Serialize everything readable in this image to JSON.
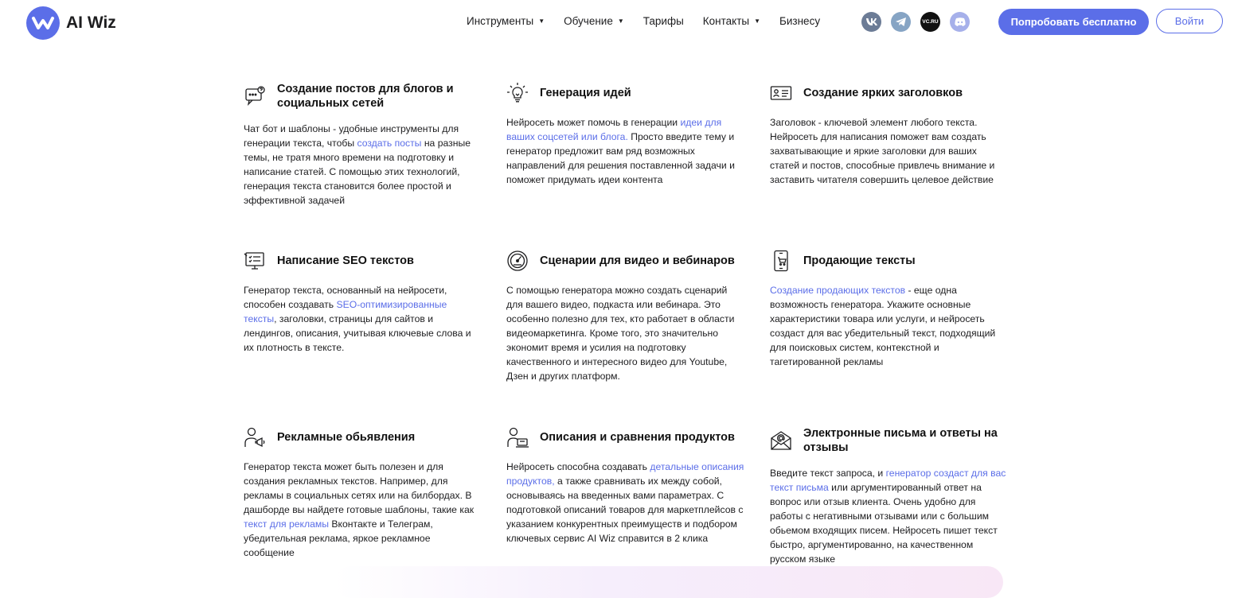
{
  "header": {
    "logo_text": "AI Wiz",
    "nav": [
      {
        "label": "Инструменты",
        "dropdown": true
      },
      {
        "label": "Обучение",
        "dropdown": true
      },
      {
        "label": "Тарифы",
        "dropdown": false
      },
      {
        "label": "Контакты",
        "dropdown": true
      },
      {
        "label": "Бизнесу",
        "dropdown": false
      }
    ],
    "socials": [
      "vk",
      "telegram",
      "vc.ru",
      "discord"
    ],
    "vc_label": "VC.RU",
    "try_free": "Попробовать бесплатно",
    "login": "Войти"
  },
  "colors": {
    "accent": "#5b6ee8",
    "text": "#1d1d1f",
    "link": "#5b6ee8"
  },
  "cards": [
    {
      "icon": "chat-bubble-icon",
      "title": "Создание постов для блогов и социальных сетей",
      "parts": [
        {
          "t": "Чат бот и шаблоны - удобные инструменты для генерации текста, чтобы "
        },
        {
          "t": "создать посты",
          "link": true
        },
        {
          "t": " на разные темы, не тратя много времени на подготовку и написание статей. С помощью этих технологий, генерация текста становится более простой и эффективной задачей"
        }
      ]
    },
    {
      "icon": "lightbulb-icon",
      "title": "Генерация идей",
      "parts": [
        {
          "t": "Нейросеть может помочь в генерации "
        },
        {
          "t": "идеи для ваших соцсетей или блога.",
          "link": true
        },
        {
          "t": " Просто введите тему и генератор предложит вам ряд возможных направлений для решения поставленной задачи и поможет придумать идеи контента"
        }
      ]
    },
    {
      "icon": "id-card-icon",
      "title": "Создание ярких заголовков",
      "parts": [
        {
          "t": "Заголовок - ключевой элемент любого текста. Нейросеть для написания поможет вам создать захватывающие и яркие заголовки для ваших статей и постов, способные привлечь внимание и заставить читателя совершить целевое действие"
        }
      ]
    },
    {
      "icon": "monitor-checklist-icon",
      "title": "Написание SEO текстов",
      "parts": [
        {
          "t": "Генератор текста, основанный на нейросети, способен создавать "
        },
        {
          "t": "SEO-оптимизированные тексты",
          "link": true
        },
        {
          "t": ", заголовки, страницы для сайтов и лендингов, описания, учитывая ключевые слова и их плотность в тексте."
        }
      ]
    },
    {
      "icon": "gauge-icon",
      "title": "Сценарии для видео и вебинаров",
      "parts": [
        {
          "t": "С помощью генератора можно создать сценарий для вашего видео, подкаста или вебинара. Это особенно полезно для тех, кто работает в области видеомаркетинга. Кроме того, это значительно экономит время и усилия на подготовку качественного и интересного видео для Youtube, Дзен и других платформ."
        }
      ]
    },
    {
      "icon": "phone-cart-icon",
      "title": "Продающие тексты",
      "parts": [
        {
          "t": "Создание продающих текстов",
          "link": true
        },
        {
          "t": " - еще одна возможность генератора. Укажите основные характеристики товара или услуги, и нейросеть создаст для вас убедительный текст, подходящий для поисковых систем, контекстной и тагетированной рекламы"
        }
      ]
    },
    {
      "icon": "person-megaphone-icon",
      "title": "Рекламные обьявления",
      "parts": [
        {
          "t": "Генератор текста может быть полезен и для создания рекламных текстов. Например, для рекламы в социальных сетях или на билбордах. В дашборде вы найдете готовые шаблоны, такие как "
        },
        {
          "t": "текст для рекламы",
          "link": true
        },
        {
          "t": " Вконтакте и Телеграм, убедительная реклама, яркое рекламное сообщение"
        }
      ]
    },
    {
      "icon": "person-laptop-icon",
      "title": "Описания и сравнения продуктов",
      "parts": [
        {
          "t": "Нейросеть способна создавать "
        },
        {
          "t": "детальные описания продуктов,",
          "link": true
        },
        {
          "t": " а также сравнивать их между собой, основываясь на введенных вами параметрах. С подготовкой описаний товаров для маркетплейсов с указанием конкурентных преимуществ и подбором ключевых сервис AI Wiz справится в 2 клика"
        }
      ]
    },
    {
      "icon": "envelope-at-icon",
      "title": "Электронные письма и ответы на отзывы",
      "parts": [
        {
          "t": "Введите текст запроса, и "
        },
        {
          "t": "генератор создаст для вас текст письма",
          "link": true
        },
        {
          "t": " или аргументированный ответ на вопрос или отзыв клиента. Очень удобно для работы с негативными отзывами или с большим обьемом входящих писем. Нейросеть пишет текст быстро, аргументированно, на качественном русском языке"
        }
      ]
    }
  ]
}
